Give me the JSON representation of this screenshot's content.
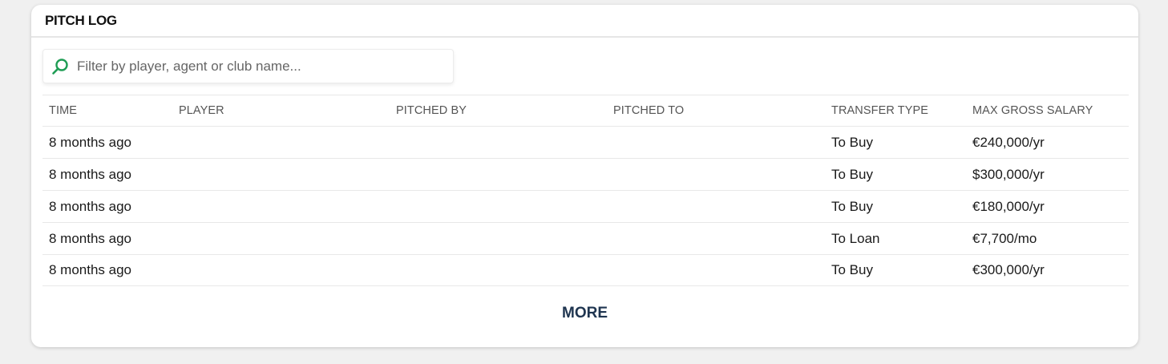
{
  "header": {
    "title": "PITCH LOG"
  },
  "search": {
    "placeholder": "Filter by player, agent or club name...",
    "icon": "search-icon"
  },
  "table": {
    "columns": [
      "TIME",
      "PLAYER",
      "PITCHED BY",
      "PITCHED TO",
      "TRANSFER TYPE",
      "MAX GROSS SALARY"
    ],
    "rows": [
      {
        "time": "8 months ago",
        "player": "",
        "pitched_by": "",
        "pitched_to": "",
        "transfer_type": "To Buy",
        "salary": "€240,000/yr"
      },
      {
        "time": "8 months ago",
        "player": "",
        "pitched_by": "",
        "pitched_to": "",
        "transfer_type": "To Buy",
        "salary": "$300,000/yr"
      },
      {
        "time": "8 months ago",
        "player": "",
        "pitched_by": "",
        "pitched_to": "",
        "transfer_type": "To Buy",
        "salary": "€180,000/yr"
      },
      {
        "time": "8 months ago",
        "player": "",
        "pitched_by": "",
        "pitched_to": "",
        "transfer_type": "To Loan",
        "salary": "€7,700/mo"
      },
      {
        "time": "8 months ago",
        "player": "",
        "pitched_by": "",
        "pitched_to": "",
        "transfer_type": "To Buy",
        "salary": "€300,000/yr"
      }
    ]
  },
  "footer": {
    "more_label": "MORE"
  },
  "colors": {
    "accent_green": "#1f9d55",
    "more_text": "#1f3550"
  }
}
